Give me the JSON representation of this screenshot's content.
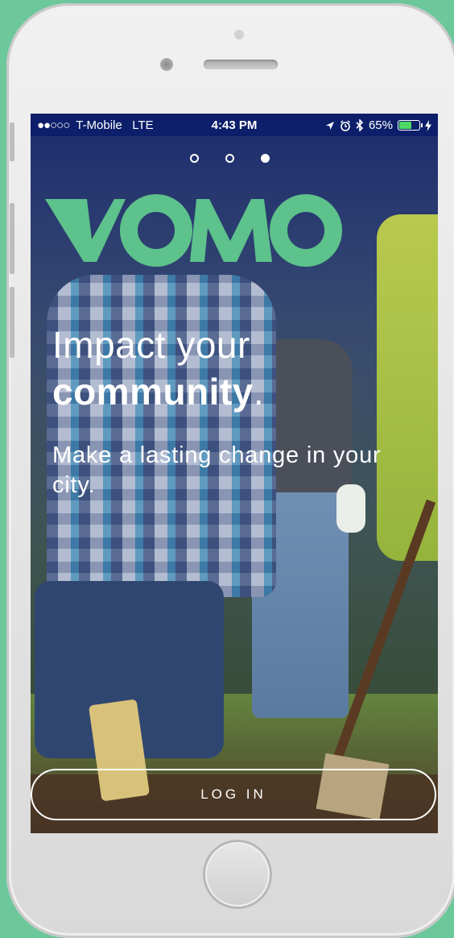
{
  "status_bar": {
    "signal_dots": "●●○○○",
    "carrier": "T-Mobile",
    "network": "LTE",
    "time": "4:43 PM",
    "battery_percent": "65%",
    "battery_level": 0.65,
    "icons": [
      "location-arrow-icon",
      "alarm-icon",
      "bluetooth-icon",
      "battery-icon",
      "charging-bolt-icon"
    ]
  },
  "pager": {
    "pages": 3,
    "active_index": 2
  },
  "logo": {
    "text": "VOMO",
    "color": "#5dc28b"
  },
  "headline": {
    "line1": "Impact your",
    "emphasis": "community",
    "suffix": "."
  },
  "subheadline": "Make a lasting change in your city.",
  "login_button": {
    "label": "LOG IN"
  },
  "colors": {
    "status_bar_bg": "#0d1f6a",
    "overlay_top": "#16246e",
    "device_bg": "#6cc79a"
  }
}
